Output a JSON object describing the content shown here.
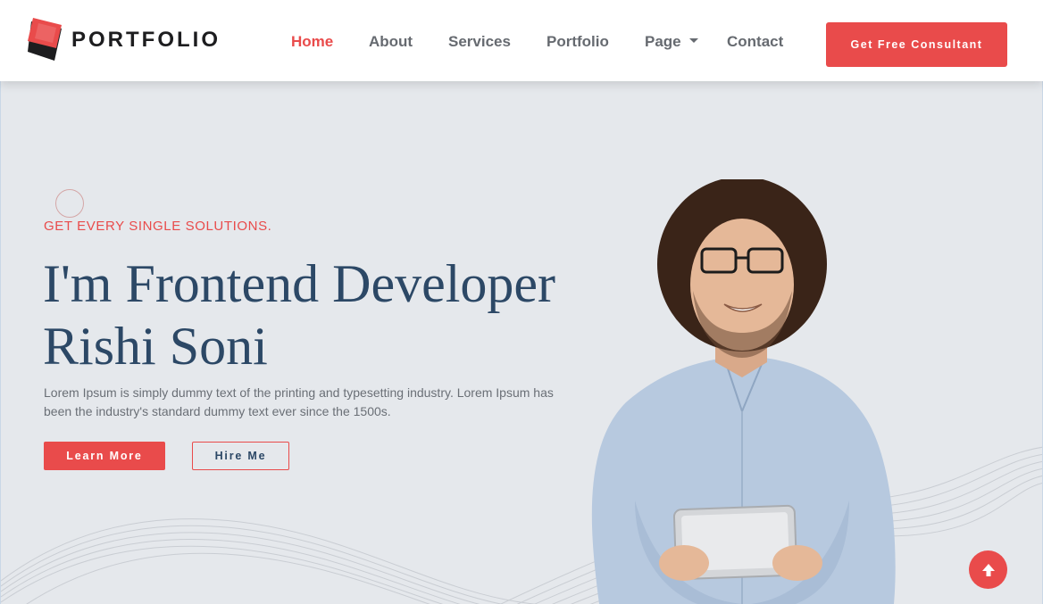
{
  "brand": {
    "name": "PORTFOLIO",
    "logo_icon": "cube-logo-icon",
    "accent": "#e94b4b",
    "heading_color": "#2c4866"
  },
  "nav": {
    "home": "Home",
    "about": "About",
    "services": "Services",
    "portfolio": "Portfolio",
    "page": "Page",
    "contact": "Contact",
    "active": "Home"
  },
  "header": {
    "cta_label": "Get Free Consultant"
  },
  "hero": {
    "tagline": "GET EVERY SINGLE SOLUTIONS.",
    "headline_line1": "I'm Frontend Developer",
    "headline_line2": "Rishi Soni",
    "description": "Lorem Ipsum is simply dummy text of the printing and typesetting industry. Lorem Ipsum has been the industry's standard dummy text ever since the 1500s.",
    "primary_button": "Learn More",
    "secondary_button": "Hire Me"
  },
  "scroll_top": {
    "icon": "arrow-up-icon"
  }
}
